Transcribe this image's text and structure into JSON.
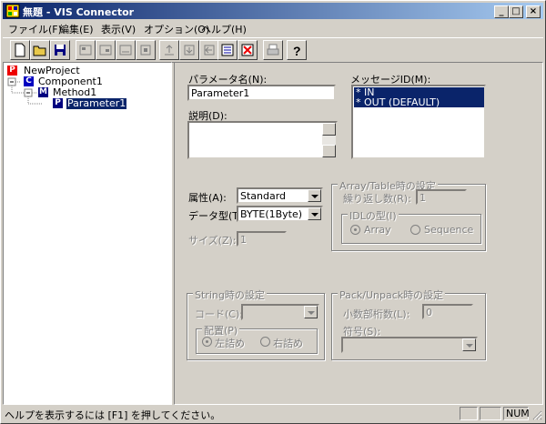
{
  "window": {
    "title": "無題 - VIS Connector",
    "controls": {
      "minimize": "_",
      "maximize": "□",
      "close": "×"
    }
  },
  "menu": [
    "ファイル(F)",
    "編集(E)",
    "表示(V)",
    "オプション(O)",
    "ヘルプ(H)"
  ],
  "toolbar": {
    "buttons": [
      "new-document-icon",
      "open-folder-icon",
      "save-disk-icon",
      "add-component-icon",
      "add-method-icon",
      "add-property-icon",
      "add-parameter-icon",
      "move-up-icon",
      "move-down-icon",
      "move-left-icon",
      "generate-icon",
      "delete-icon",
      "print-icon",
      "help-icon"
    ]
  },
  "tree": {
    "nodes": [
      {
        "icon": "P",
        "label": "NewProject"
      },
      {
        "icon": "C",
        "label": "Component1"
      },
      {
        "icon": "M",
        "label": "Method1"
      },
      {
        "icon": "P",
        "label": "Parameter1"
      }
    ]
  },
  "form": {
    "param_name_label": "パラメータ名(N):",
    "param_name_value": "Parameter1",
    "desc_label": "説明(D):",
    "desc_value": "",
    "message_id_label": "メッセージID(M):",
    "message_ids": [
      "* IN",
      "* OUT (DEFAULT)"
    ],
    "attr_label": "属性(A):",
    "attr_value": "Standard",
    "datatype_label": "データ型(T):",
    "datatype_value": "BYTE(1Byte)",
    "size_label": "サイズ(Z):",
    "size_value": "1",
    "array_group": "Array/Table時の設定",
    "repeat_label": "繰り返し数(R):",
    "repeat_value": "1",
    "idl_group": "IDLの型(I)",
    "idl_array": "Array",
    "idl_sequence": "Sequence",
    "string_group": "String時の設定",
    "code_label": "コード(C):",
    "code_value": "",
    "layout_group": "配置(P)",
    "left_align": "左詰め",
    "right_align": "右詰め",
    "pack_group": "Pack/Unpack時の設定",
    "decimal_label": "小数部桁数(L):",
    "decimal_value": "0",
    "sign_label": "符号(S):",
    "sign_value": ""
  },
  "status": {
    "text": "ヘルプを表示するには [F1] を押してください。",
    "num": "NUM"
  },
  "colors": {
    "titlebar": "#0a246a",
    "face": "#d4d0c8",
    "selection": "#0a246a"
  }
}
